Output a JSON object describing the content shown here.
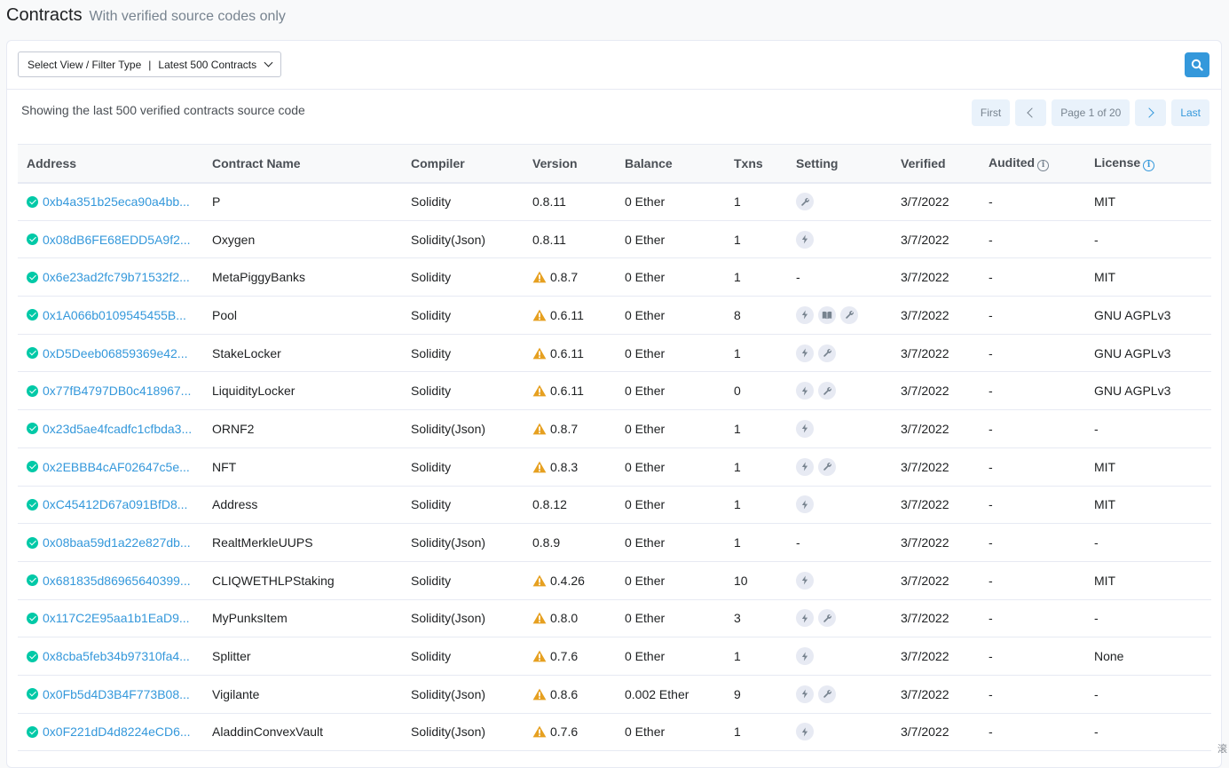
{
  "page": {
    "title": "Contracts",
    "subtitle": "With verified source codes only"
  },
  "filter": {
    "label": "Select View / Filter Type",
    "separator": "|",
    "selected": "Latest 500 Contracts"
  },
  "search_icon": "search-icon",
  "summary": "Showing the last 500 verified contracts source code",
  "pagination": {
    "first": "First",
    "page_label": "Page 1 of 20",
    "last": "Last"
  },
  "table": {
    "headers": [
      "Address",
      "Contract Name",
      "Compiler",
      "Version",
      "Balance",
      "Txns",
      "Setting",
      "Verified",
      "Audited",
      "License"
    ],
    "rows": [
      {
        "address": "0xb4a351b25eca90a4bb...",
        "name": "P",
        "compiler": "Solidity",
        "warn": false,
        "version": "0.8.11",
        "balance": "0 Ether",
        "txns": "1",
        "settings": [
          "wrench-icon"
        ],
        "setting_text": "",
        "verified": "3/7/2022",
        "audited": "-",
        "license": "MIT"
      },
      {
        "address": "0x08dB6FE68EDD5A9f2...",
        "name": "Oxygen",
        "compiler": "Solidity(Json)",
        "warn": false,
        "version": "0.8.11",
        "balance": "0 Ether",
        "txns": "1",
        "settings": [
          "lightning-icon"
        ],
        "setting_text": "",
        "verified": "3/7/2022",
        "audited": "-",
        "license": "-"
      },
      {
        "address": "0x6e23ad2fc79b71532f2...",
        "name": "MetaPiggyBanks",
        "compiler": "Solidity",
        "warn": true,
        "version": "0.8.7",
        "balance": "0 Ether",
        "txns": "1",
        "settings": [],
        "setting_text": "-",
        "verified": "3/7/2022",
        "audited": "-",
        "license": "MIT"
      },
      {
        "address": "0x1A066b0109545455B...",
        "name": "Pool",
        "compiler": "Solidity",
        "warn": true,
        "version": "0.6.11",
        "balance": "0 Ether",
        "txns": "8",
        "settings": [
          "lightning-icon",
          "book-icon",
          "wrench-icon"
        ],
        "setting_text": "",
        "verified": "3/7/2022",
        "audited": "-",
        "license": "GNU AGPLv3"
      },
      {
        "address": "0xD5Deeb06859369e42...",
        "name": "StakeLocker",
        "compiler": "Solidity",
        "warn": true,
        "version": "0.6.11",
        "balance": "0 Ether",
        "txns": "1",
        "settings": [
          "lightning-icon",
          "wrench-icon"
        ],
        "setting_text": "",
        "verified": "3/7/2022",
        "audited": "-",
        "license": "GNU AGPLv3"
      },
      {
        "address": "0x77fB4797DB0c418967...",
        "name": "LiquidityLocker",
        "compiler": "Solidity",
        "warn": true,
        "version": "0.6.11",
        "balance": "0 Ether",
        "txns": "0",
        "settings": [
          "lightning-icon",
          "wrench-icon"
        ],
        "setting_text": "",
        "verified": "3/7/2022",
        "audited": "-",
        "license": "GNU AGPLv3"
      },
      {
        "address": "0x23d5ae4fcadfc1cfbda3...",
        "name": "ORNF2",
        "compiler": "Solidity(Json)",
        "warn": true,
        "version": "0.8.7",
        "balance": "0 Ether",
        "txns": "1",
        "settings": [
          "lightning-icon"
        ],
        "setting_text": "",
        "verified": "3/7/2022",
        "audited": "-",
        "license": "-"
      },
      {
        "address": "0x2EBBB4cAF02647c5e...",
        "name": "NFT",
        "compiler": "Solidity",
        "warn": true,
        "version": "0.8.3",
        "balance": "0 Ether",
        "txns": "1",
        "settings": [
          "lightning-icon",
          "wrench-icon"
        ],
        "setting_text": "",
        "verified": "3/7/2022",
        "audited": "-",
        "license": "MIT"
      },
      {
        "address": "0xC45412D67a091BfD8...",
        "name": "Address",
        "compiler": "Solidity",
        "warn": false,
        "version": "0.8.12",
        "balance": "0 Ether",
        "txns": "1",
        "settings": [
          "lightning-icon"
        ],
        "setting_text": "",
        "verified": "3/7/2022",
        "audited": "-",
        "license": "MIT"
      },
      {
        "address": "0x08baa59d1a22e827db...",
        "name": "RealtMerkleUUPS",
        "compiler": "Solidity(Json)",
        "warn": false,
        "version": "0.8.9",
        "balance": "0 Ether",
        "txns": "1",
        "settings": [],
        "setting_text": "-",
        "verified": "3/7/2022",
        "audited": "-",
        "license": "-"
      },
      {
        "address": "0x681835d86965640399...",
        "name": "CLIQWETHLPStaking",
        "compiler": "Solidity",
        "warn": true,
        "version": "0.4.26",
        "balance": "0 Ether",
        "txns": "10",
        "settings": [
          "lightning-icon"
        ],
        "setting_text": "",
        "verified": "3/7/2022",
        "audited": "-",
        "license": "MIT"
      },
      {
        "address": "0x117C2E95aa1b1EaD9...",
        "name": "MyPunksItem",
        "compiler": "Solidity(Json)",
        "warn": true,
        "version": "0.8.0",
        "balance": "0 Ether",
        "txns": "3",
        "settings": [
          "lightning-icon",
          "wrench-icon"
        ],
        "setting_text": "",
        "verified": "3/7/2022",
        "audited": "-",
        "license": "-"
      },
      {
        "address": "0x8cba5feb34b97310fa4...",
        "name": "Splitter",
        "compiler": "Solidity",
        "warn": true,
        "version": "0.7.6",
        "balance": "0 Ether",
        "txns": "1",
        "settings": [
          "lightning-icon"
        ],
        "setting_text": "",
        "verified": "3/7/2022",
        "audited": "-",
        "license": "None"
      },
      {
        "address": "0x0Fb5d4D3B4F773B08...",
        "name": "Vigilante",
        "compiler": "Solidity(Json)",
        "warn": true,
        "version": "0.8.6",
        "balance": "0.002 Ether",
        "txns": "9",
        "settings": [
          "lightning-icon",
          "wrench-icon"
        ],
        "setting_text": "",
        "verified": "3/7/2022",
        "audited": "-",
        "license": "-"
      },
      {
        "address": "0x0F221dD4d8224eCD6...",
        "name": "AladdinConvexVault",
        "compiler": "Solidity(Json)",
        "warn": true,
        "version": "0.7.6",
        "balance": "0 Ether",
        "txns": "1",
        "settings": [
          "lightning-icon"
        ],
        "setting_text": "",
        "verified": "3/7/2022",
        "audited": "-",
        "license": "-"
      }
    ]
  },
  "colors": {
    "accent": "#3498db",
    "verified_check": "#00c9a7",
    "warning": "#e6a020"
  },
  "corner_glyph": "滚"
}
